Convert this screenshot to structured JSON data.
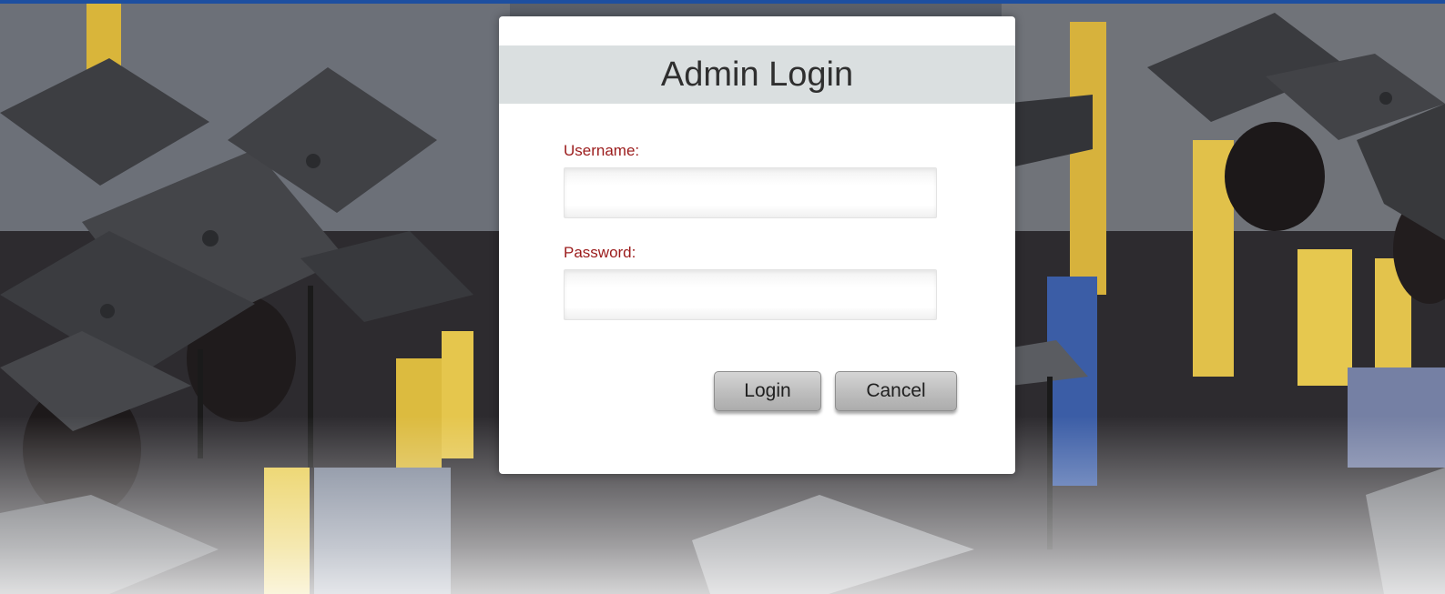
{
  "login_dialog": {
    "title": "Admin Login",
    "username": {
      "label": "Username:",
      "value": ""
    },
    "password": {
      "label": "Password:",
      "value": ""
    },
    "buttons": {
      "login": "Login",
      "cancel": "Cancel"
    }
  },
  "colors": {
    "top_bar": "#1d4fa0",
    "header_band": "#dadfe0",
    "label_text": "#9b1b1b",
    "button_face": "#bdbdbd"
  },
  "background": {
    "subject": "graduation-crowd"
  }
}
